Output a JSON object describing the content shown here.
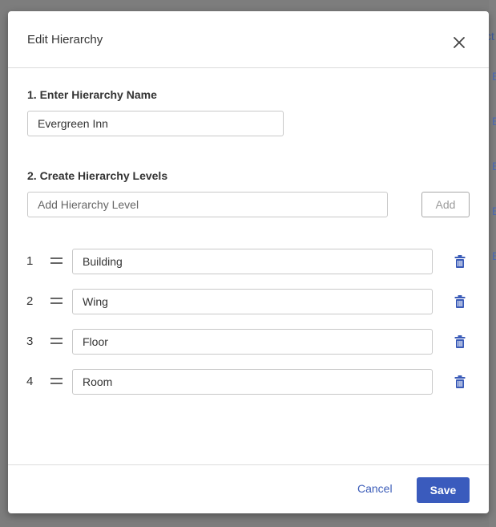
{
  "background": {
    "edge_text": "ct",
    "edge_links": [
      "E",
      "E",
      "E",
      "E",
      "E"
    ]
  },
  "modal": {
    "title": "Edit Hierarchy",
    "name_section": {
      "label": "1. Enter Hierarchy Name",
      "value": "Evergreen Inn"
    },
    "levels_section": {
      "label": "2. Create Hierarchy Levels",
      "add_placeholder": "Add Hierarchy Level",
      "add_value": "",
      "add_button": "Add"
    },
    "levels": [
      {
        "number": "1",
        "value": "Building"
      },
      {
        "number": "2",
        "value": "Wing"
      },
      {
        "number": "3",
        "value": "Floor"
      },
      {
        "number": "4",
        "value": "Room"
      }
    ],
    "footer": {
      "cancel": "Cancel",
      "save": "Save"
    }
  },
  "colors": {
    "primary": "#3a5bbd",
    "link": "#3b5cb8",
    "delete_icon": "#3b5cb8",
    "overlay": "#7d7d7d"
  }
}
